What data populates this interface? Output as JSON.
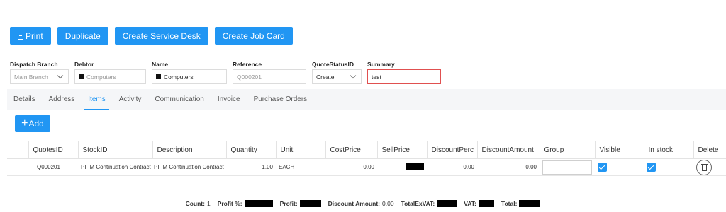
{
  "toolbar": {
    "print": "Print",
    "duplicate": "Duplicate",
    "create_service_desk": "Create Service Desk",
    "create_job_card": "Create Job Card"
  },
  "form": {
    "dispatch_branch": {
      "label": "Dispatch Branch",
      "value": "Main Branch"
    },
    "debtor": {
      "label": "Debtor",
      "placeholder": "Computers"
    },
    "name": {
      "label": "Name",
      "value": "Computers"
    },
    "reference": {
      "label": "Reference",
      "placeholder": "Q000201"
    },
    "quote_status": {
      "label": "QuoteStatusID",
      "value": "Create"
    },
    "summary": {
      "label": "Summary",
      "value": "test"
    }
  },
  "tabs": [
    "Details",
    "Address",
    "Items",
    "Activity",
    "Communication",
    "Invoice",
    "Purchase Orders"
  ],
  "active_tab": "Items",
  "add_button": "Add",
  "table": {
    "columns": [
      "",
      "QuotesID",
      "StockID",
      "Description",
      "Quantity",
      "Unit",
      "CostPrice",
      "SellPrice",
      "DiscountPerc",
      "DiscountAmount",
      "Group",
      "Visible",
      "In stock",
      "Delete"
    ],
    "rows": [
      {
        "quotes_id": "Q000201",
        "stock_id": "PFIM Continuation Contract",
        "description": "PFIM Continuation Contract",
        "quantity": "1.00",
        "unit": "EACH",
        "cost_price": "0.00",
        "discount_perc": "0.00",
        "discount_amount": "0.00",
        "visible": true,
        "in_stock": true
      }
    ]
  },
  "footer": {
    "count_label": "Count:",
    "count_value": "1",
    "profit_pct_label": "Profit %:",
    "profit_label": "Profit:",
    "discount_label": "Discount Amount:",
    "discount_value": "0.00",
    "total_ex_vat_label": "TotalExVAT:",
    "vat_label": "VAT:",
    "total_label": "Total:"
  },
  "colors": {
    "accent": "#2196f3",
    "error_border": "#e05050"
  }
}
